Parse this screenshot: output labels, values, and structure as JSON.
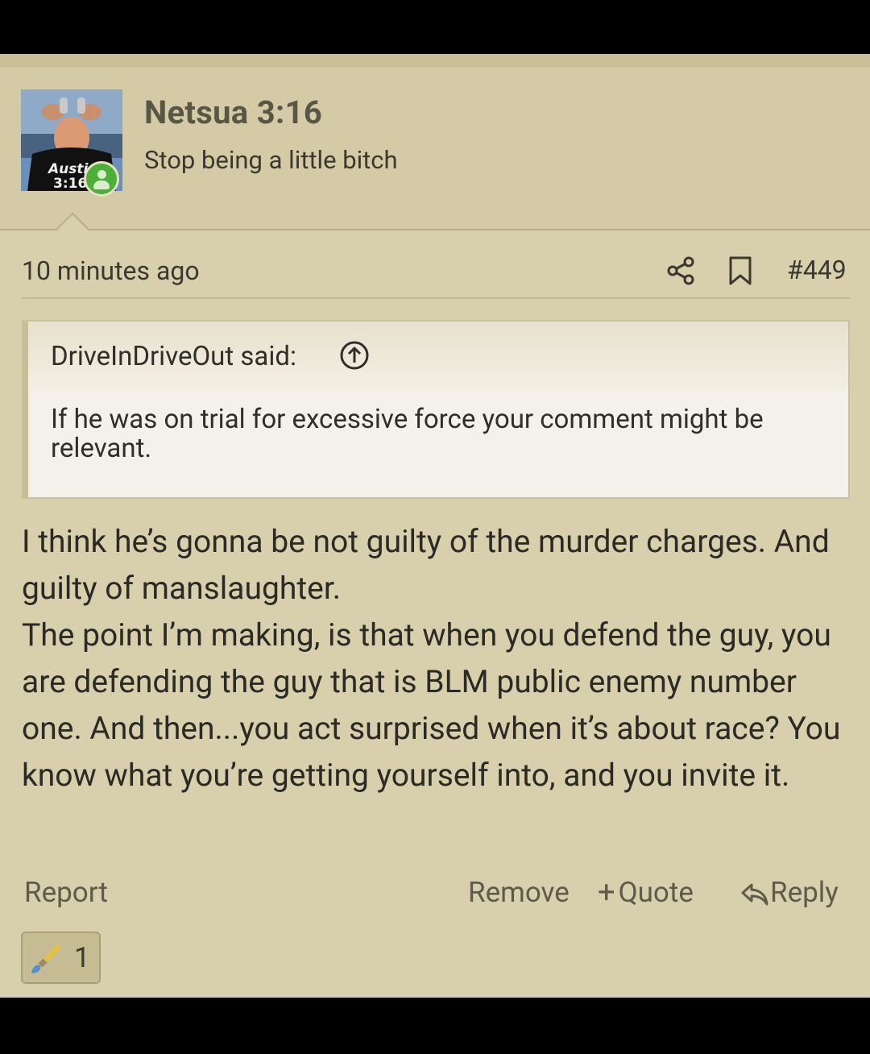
{
  "post": {
    "username": "Netsua 3:16",
    "user_title": "Stop being a little bitch",
    "timestamp": "10 minutes ago",
    "post_number": "#449",
    "quote": {
      "author": "DriveInDriveOut said:",
      "text": "If he was on trial for excessive force your comment might be relevant."
    },
    "body": "I think he’s gonna be not guilty of the murder charges. And guilty of manslaughter.\nThe point I’m making, is that when you defend the guy, you are defending the guy that is BLM public enemy number one. And then...you act surprised when it’s about race? You know what you’re getting yourself into, and you invite it.",
    "actions": {
      "report": "Report",
      "remove": "Remove",
      "quote": "Quote",
      "reply": "Reply"
    },
    "reaction": {
      "icon": "paintbrush-icon",
      "count": "1"
    },
    "avatar_text": "Austin 3:16"
  },
  "colors": {
    "background": "#d8cfad",
    "header": "#d4cba6",
    "quote_bg": "#f4f1ea",
    "online": "#4caf3a"
  }
}
